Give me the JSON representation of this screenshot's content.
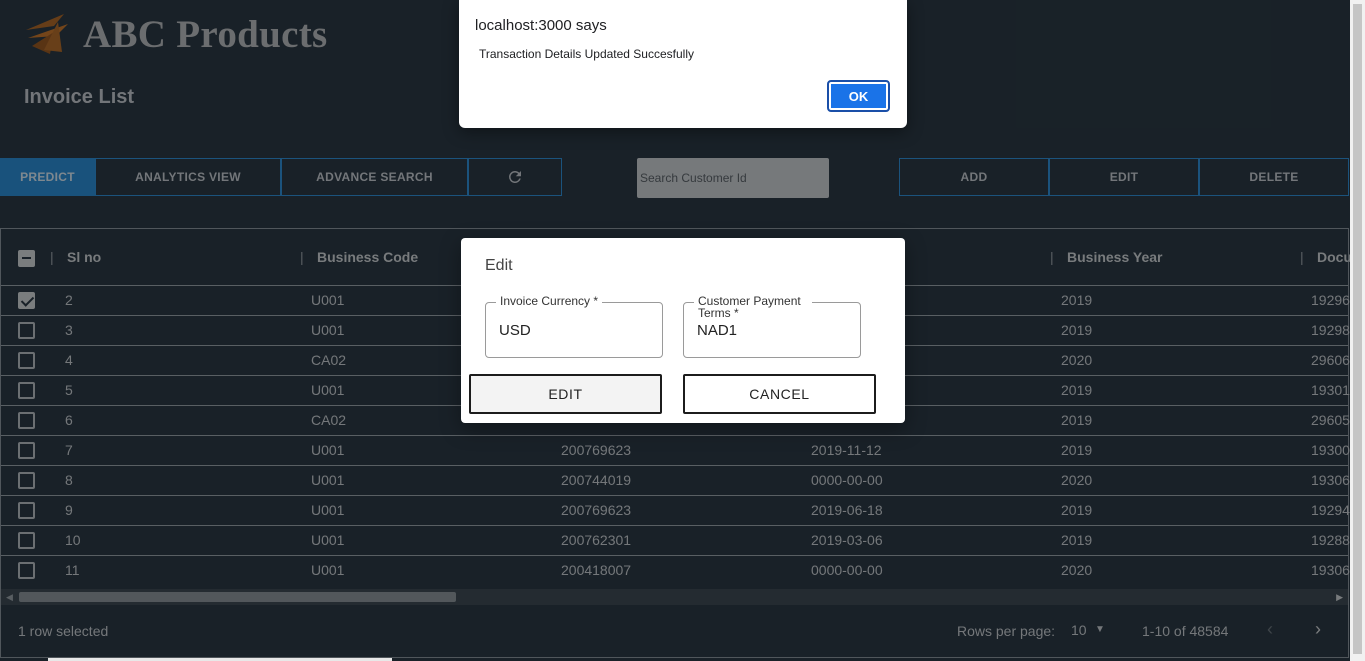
{
  "app": {
    "brand": "ABC Products",
    "page_title": "Invoice List"
  },
  "toolbar": {
    "predict": "PREDICT",
    "analytics": "ANALYTICS VIEW",
    "advance_search": "ADVANCE SEARCH",
    "refresh_icon": "refresh-icon",
    "search_placeholder": "Search Customer Id",
    "add": "ADD",
    "edit": "EDIT",
    "delete": "DELETE"
  },
  "table": {
    "columns": [
      "Sl no",
      "Business Code",
      "Business Year",
      "Docu"
    ],
    "rows": [
      {
        "sl": "2",
        "code": "U001",
        "cust": "",
        "date": "",
        "year": "2019",
        "doc": "19296",
        "checked": true
      },
      {
        "sl": "3",
        "code": "U001",
        "cust": "",
        "date": "",
        "year": "2019",
        "doc": "19298",
        "checked": false
      },
      {
        "sl": "4",
        "code": "CA02",
        "cust": "",
        "date": "",
        "year": "2020",
        "doc": "29606",
        "checked": false
      },
      {
        "sl": "5",
        "code": "U001",
        "cust": "",
        "date": "",
        "year": "2019",
        "doc": "19301",
        "checked": false
      },
      {
        "sl": "6",
        "code": "CA02",
        "cust": "",
        "date": "",
        "year": "2019",
        "doc": "29605",
        "checked": false
      },
      {
        "sl": "7",
        "code": "U001",
        "cust": "200769623",
        "date": "2019-11-12",
        "year": "2019",
        "doc": "19300",
        "checked": false
      },
      {
        "sl": "8",
        "code": "U001",
        "cust": "200744019",
        "date": "0000-00-00",
        "year": "2020",
        "doc": "19306",
        "checked": false
      },
      {
        "sl": "9",
        "code": "U001",
        "cust": "200769623",
        "date": "2019-06-18",
        "year": "2019",
        "doc": "19294",
        "checked": false
      },
      {
        "sl": "10",
        "code": "U001",
        "cust": "200762301",
        "date": "2019-03-06",
        "year": "2019",
        "doc": "19288",
        "checked": false
      },
      {
        "sl": "11",
        "code": "U001",
        "cust": "200418007",
        "date": "0000-00-00",
        "year": "2020",
        "doc": "19306",
        "checked": false
      }
    ]
  },
  "footer": {
    "selection": "1 row selected",
    "rows_per_page_label": "Rows per page:",
    "rows_per_page_value": "10",
    "range": "1-10 of 48584"
  },
  "edit_dialog": {
    "title": "Edit",
    "currency_label": "Invoice Currency *",
    "currency_value": "USD",
    "terms_label": "Customer Payment Terms *",
    "terms_value": "NAD1",
    "edit_button": "EDIT",
    "cancel_button": "CANCEL"
  },
  "alert": {
    "title": "localhost:3000 says",
    "message": "Transaction Details Updated Succesfully",
    "ok": "OK",
    "ok_color": "#1a73e8"
  }
}
